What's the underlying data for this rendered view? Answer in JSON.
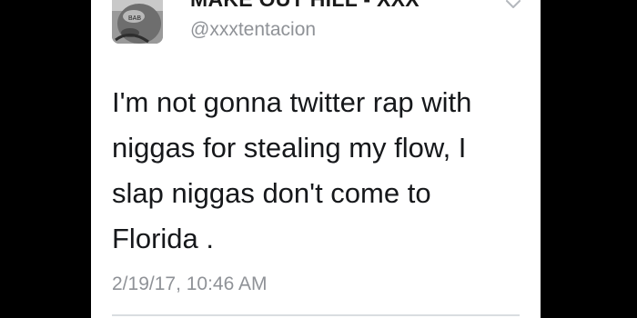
{
  "tweet": {
    "display_name": "MAKE OUT HILL - XXX",
    "handle": "@xxxtentacion",
    "text": "I'm not gonna twitter rap with\nniggas for stealing my flow, I\nslap niggas don't come to\nFlorida .",
    "timestamp": "2/19/17, 10:46 AM",
    "avatar_tattoo_text": "BAB"
  },
  "colors": {
    "background": "#000000",
    "card": "#ffffff",
    "text": "#16181b",
    "secondary_text": "#8f9297",
    "divider": "#d9dde1"
  },
  "icons": {
    "menu": "chevron-down-icon"
  }
}
